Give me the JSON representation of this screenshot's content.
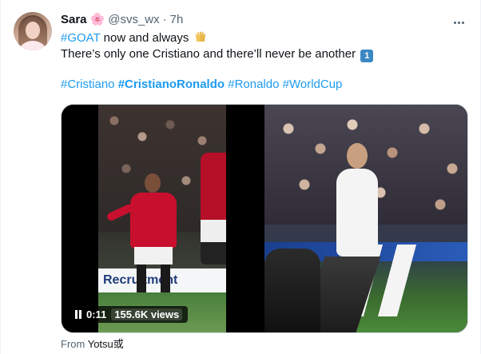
{
  "tweet": {
    "author_name": "Sara",
    "author_emoji": "🌸",
    "handle": "@svs_wx",
    "separator": "·",
    "time": "7h",
    "line1_hashtag": "#GOAT",
    "line1_text": " now and always ",
    "line2_text": "There’s only one Cristiano and there’ll never be another ",
    "keycap": "1",
    "hashtags": [
      {
        "text": "#Cristiano",
        "bold": false
      },
      {
        "text": "#CristianoRonaldo",
        "bold": true
      },
      {
        "text": "#Ronaldo",
        "bold": false
      },
      {
        "text": "#WorldCup",
        "bold": false
      }
    ]
  },
  "video": {
    "time": "0:11",
    "views": "155.6K views",
    "adboard_text": "Recruitment",
    "icon": "pause-icon"
  },
  "source": {
    "prefix": "From ",
    "name": "Yotsu或"
  },
  "colors": {
    "link": "#1d9bf0",
    "text": "#0f1419",
    "muted": "#536471"
  }
}
